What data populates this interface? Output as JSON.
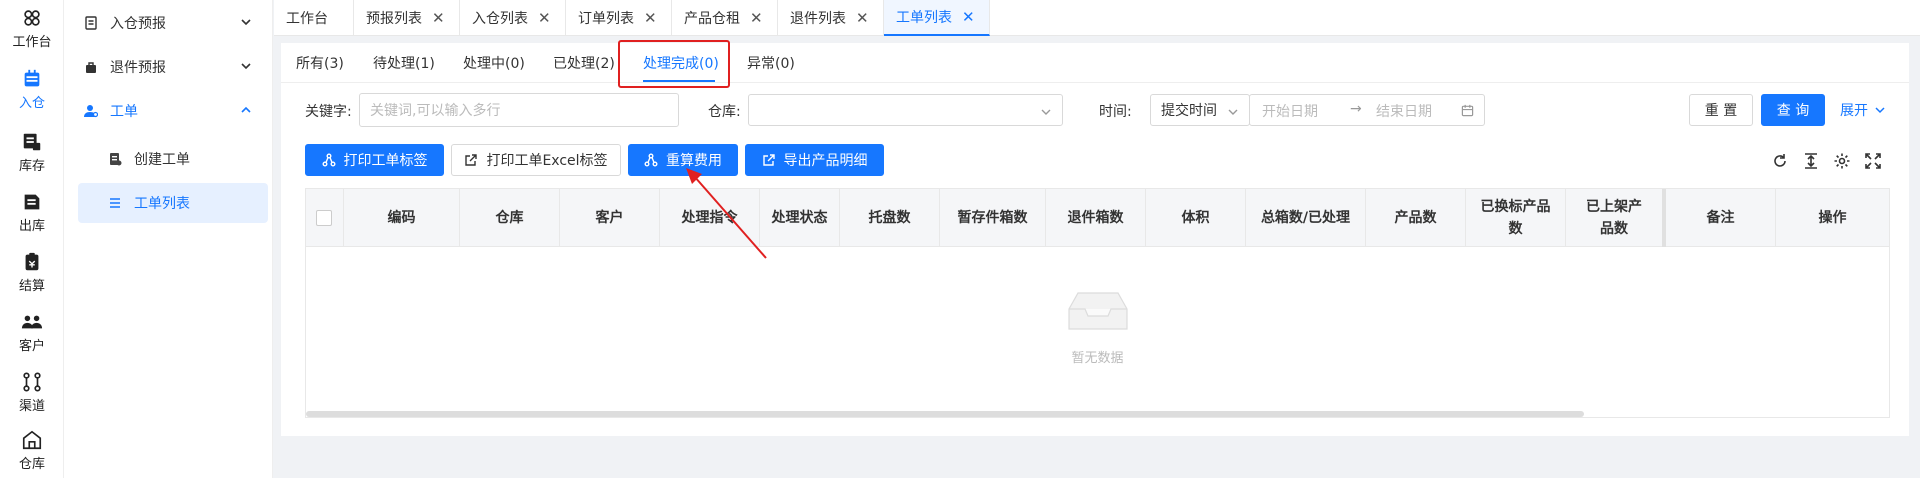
{
  "rail": [
    {
      "icon": "workbench-icon",
      "label": "工作台"
    },
    {
      "icon": "inbound-icon",
      "label": "入仓",
      "active": true
    },
    {
      "icon": "inventory-icon",
      "label": "库存"
    },
    {
      "icon": "outbound-icon",
      "label": "出库"
    },
    {
      "icon": "settlement-icon",
      "label": "结算"
    },
    {
      "icon": "customer-icon",
      "label": "客户"
    },
    {
      "icon": "channel-icon",
      "label": "渠道"
    },
    {
      "icon": "warehouse-icon",
      "label": "仓库"
    }
  ],
  "sidebar": {
    "groups": [
      {
        "icon": "document-icon",
        "label": "入仓预报"
      },
      {
        "icon": "bag-icon",
        "label": "退件预报"
      },
      {
        "icon": "user-tie-icon",
        "label": "工单"
      }
    ],
    "subs": [
      {
        "icon": "create-doc-icon",
        "label": "创建工单"
      },
      {
        "icon": "list-icon",
        "label": "工单列表"
      }
    ]
  },
  "tabs": [
    "工作台",
    "预报列表",
    "入仓列表",
    "订单列表",
    "产品仓租",
    "退件列表",
    "工单列表"
  ],
  "status_tabs": [
    "所有(3)",
    "待处理(1)",
    "处理中(0)",
    "已处理(2)",
    "处理完成(0)",
    "异常(0)"
  ],
  "filters": {
    "keyword_label": "关键字:",
    "keyword_placeholder": "关键词,可以输入多行",
    "warehouse_label": "仓库:",
    "time_label": "时间:",
    "time_type": "提交时间",
    "start_placeholder": "开始日期",
    "range_separator": "→",
    "end_placeholder": "结束日期",
    "reset": "重 置",
    "query": "查 询",
    "expand": "展开"
  },
  "actions": [
    {
      "label": "打印工单标签",
      "style": "primary"
    },
    {
      "label": "打印工单Excel标签",
      "style": "default"
    },
    {
      "label": "重算费用",
      "style": "primary"
    },
    {
      "label": "导出产品明细",
      "style": "primary"
    }
  ],
  "table": {
    "columns": [
      "编码",
      "仓库",
      "客户",
      "处理指令",
      "处理状态",
      "托盘数",
      "暂存件箱数",
      "退件箱数",
      "体积",
      "总箱数/已处理",
      "产品数",
      "已换标产品数",
      "已上架产品数",
      "备注",
      "操作"
    ],
    "empty_text": "暂无数据"
  },
  "colors": {
    "primary": "#1677ff",
    "highlight": "#e02020"
  }
}
